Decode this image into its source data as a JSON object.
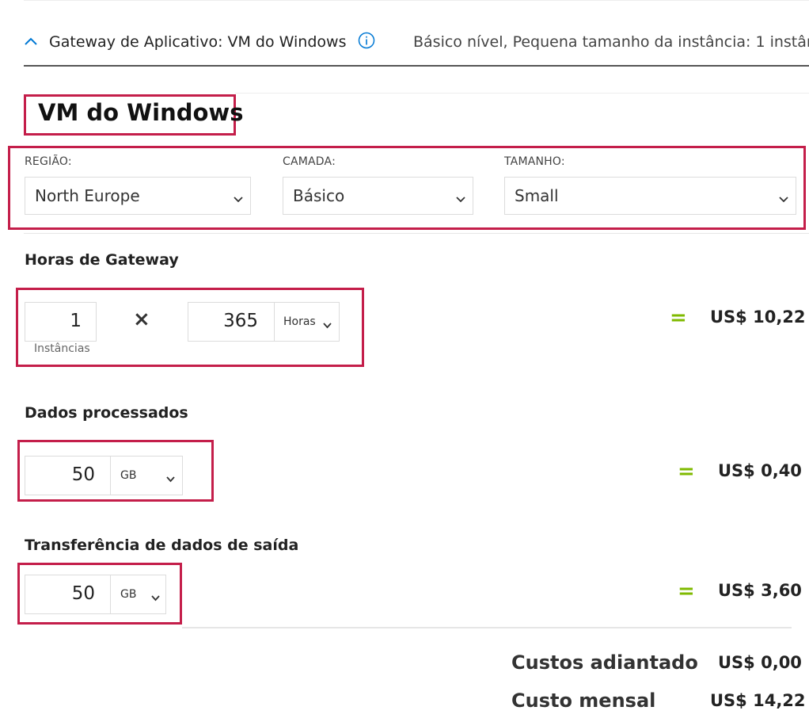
{
  "header": {
    "title": "Gateway de Aplicativo: VM do Windows",
    "summary": "Básico nível, Pequena tamanho da instância: 1 instân..."
  },
  "heading": "VM do Windows",
  "config": {
    "region": {
      "label": "REGIÃO:",
      "value": "North Europe"
    },
    "tier": {
      "label": "CAMADA:",
      "value": "Básico"
    },
    "size": {
      "label": "TAMANHO:",
      "value": "Small"
    }
  },
  "gateway_hours": {
    "title": "Horas de Gateway",
    "instances": "1",
    "instances_label": "Instâncias",
    "times": "×",
    "hours": "365",
    "unit": "Horas",
    "equals": "=",
    "price": "US$ 10,22"
  },
  "data_processed": {
    "title": "Dados processados",
    "amount": "50",
    "unit": "GB",
    "equals": "=",
    "price": "US$ 0,40"
  },
  "data_transfer": {
    "title": "Transferência de dados de saída",
    "amount": "50",
    "unit": "GB",
    "equals": "=",
    "price": "US$ 3,60"
  },
  "totals": {
    "upfront_label": "Custos adiantado",
    "upfront_value": "US$ 0,00",
    "monthly_label": "Custo mensal",
    "monthly_value": "US$ 14,22"
  },
  "colors": {
    "highlight": "#c41e4a",
    "equals": "#7fba00",
    "info": "#0078d4"
  }
}
